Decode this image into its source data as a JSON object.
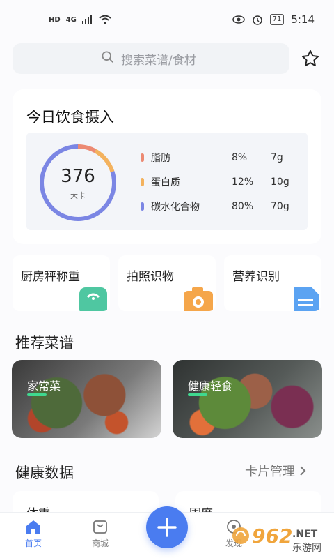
{
  "status": {
    "time": "5:14",
    "battery": "71",
    "sim": [
      "HD",
      "HD"
    ],
    "net": "4G"
  },
  "search": {
    "placeholder": "搜索菜谱/食材"
  },
  "intake": {
    "title": "今日饮食摄入",
    "kcal": "376",
    "kcal_unit": "大卡",
    "nutrients": [
      {
        "name": "脂肪",
        "pct": "8%",
        "amount": "7g",
        "color": "#ec8a73"
      },
      {
        "name": "蛋白质",
        "pct": "12%",
        "amount": "10g",
        "color": "#f3b25e"
      },
      {
        "name": "碳水化合物",
        "pct": "80%",
        "amount": "70g",
        "color": "#7b86e4"
      }
    ],
    "ring_fractions": [
      0.08,
      0.12,
      0.8
    ]
  },
  "tools": [
    {
      "label": "厨房秤称重",
      "icon": "scale-icon",
      "color": "#4fc7a1"
    },
    {
      "label": "拍照识物",
      "icon": "camera-icon",
      "color": "#f5a64a"
    },
    {
      "label": "营养识别",
      "icon": "document-icon",
      "color": "#5ba3f2"
    }
  ],
  "recipes_title": "推荐菜谱",
  "recipes": [
    {
      "label": "家常菜"
    },
    {
      "label": "健康轻食"
    }
  ],
  "health": {
    "title": "健康数据",
    "manage": "卡片管理",
    "cards": [
      "体重",
      "围度"
    ]
  },
  "tabs": [
    {
      "label": "首页",
      "active": true
    },
    {
      "label": "商城",
      "active": false
    },
    {
      "label": "发现",
      "active": false
    }
  ],
  "watermark": {
    "text": "962",
    "sub": ".NET",
    "site": "乐游网"
  }
}
